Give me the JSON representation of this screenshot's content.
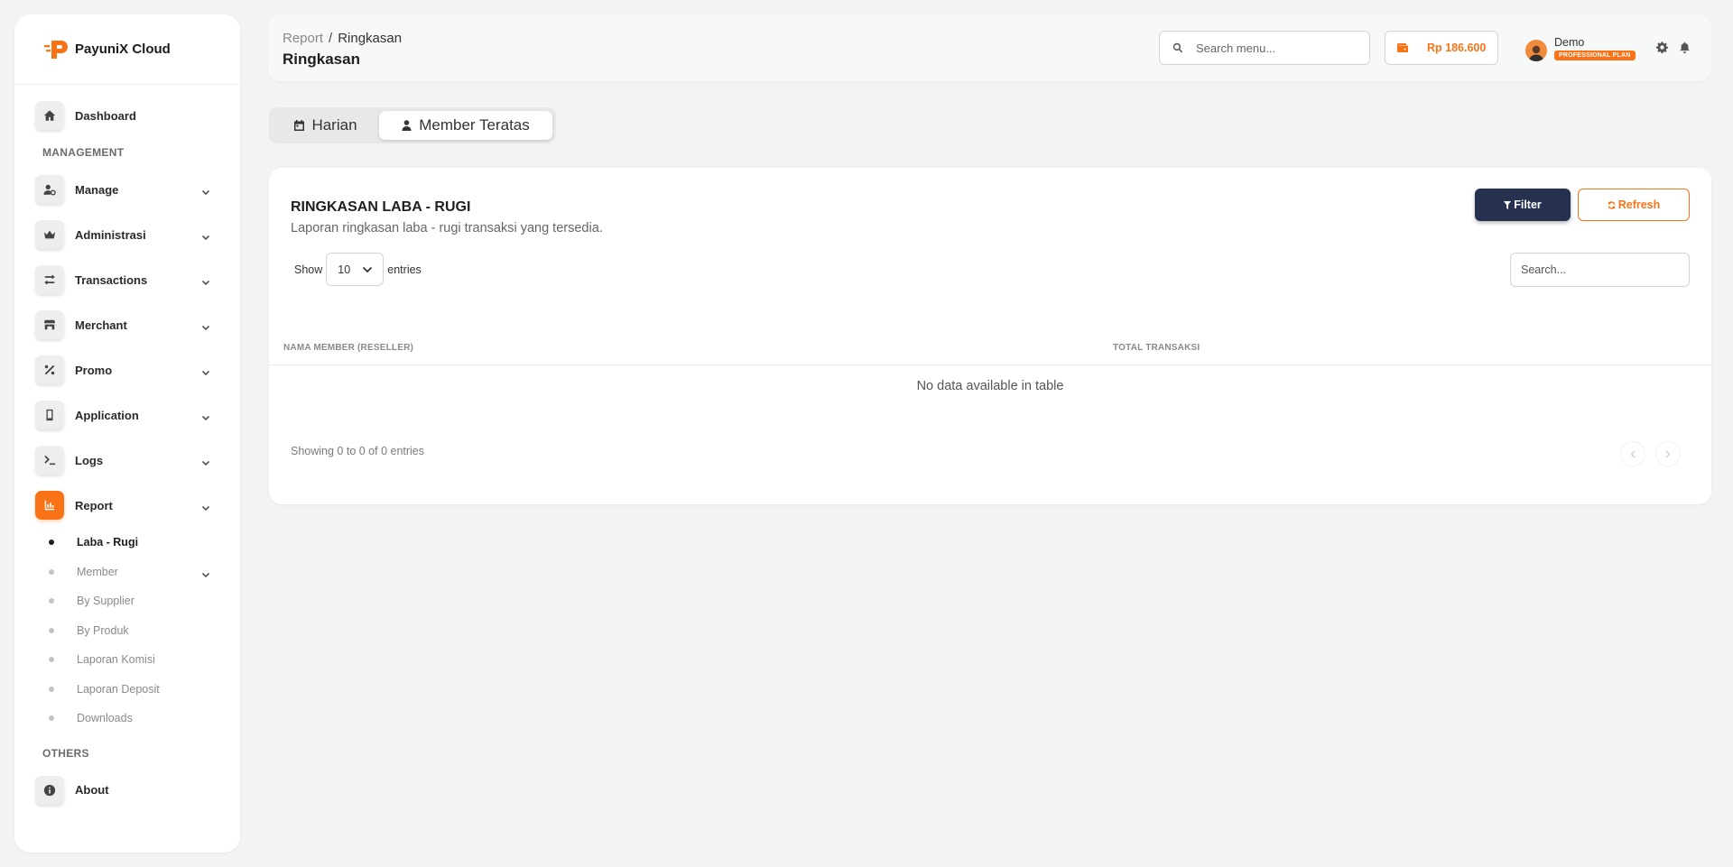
{
  "brand": {
    "name": "PayuniX Cloud"
  },
  "sidebar": {
    "dashboard": "Dashboard",
    "management_title": "MANAGEMENT",
    "menu": [
      {
        "label": "Manage",
        "icon": "user-gear-icon"
      },
      {
        "label": "Administrasi",
        "icon": "crown-icon"
      },
      {
        "label": "Transactions",
        "icon": "arrows-exchange-icon"
      },
      {
        "label": "Merchant",
        "icon": "store-icon"
      },
      {
        "label": "Promo",
        "icon": "percent-icon"
      },
      {
        "label": "Application",
        "icon": "mobile-icon"
      },
      {
        "label": "Logs",
        "icon": "terminal-icon"
      },
      {
        "label": "Report",
        "icon": "chart-icon"
      }
    ],
    "report_sub": [
      "Laba - Rugi",
      "Member",
      "By Supplier",
      "By Produk",
      "Laporan Komisi",
      "Laporan Deposit",
      "Downloads"
    ],
    "others_title": "OTHERS",
    "about": "About"
  },
  "header": {
    "breadcrumb_root": "Report",
    "breadcrumb_sep": "/",
    "breadcrumb_current": "Ringkasan",
    "title": "Ringkasan",
    "search_placeholder": "Search menu...",
    "balance": "Rp 186.600",
    "user_name": "Demo",
    "plan": "PROFESSIONAL PLAN"
  },
  "tabs": {
    "daily": "Harian",
    "top_member": "Member Teratas"
  },
  "card": {
    "title": "RINGKASAN LABA - RUGI",
    "subtitle": "Laporan ringkasan laba - rugi transaksi yang tersedia.",
    "filter_label": "Filter",
    "refresh_label": "Refresh",
    "show_label": "Show",
    "entries_label": "entries",
    "length_value": "10",
    "search_placeholder": "Search...",
    "columns": [
      "NAMA MEMBER (RESELLER)",
      "TOTAL TRANSAKSI"
    ],
    "empty_text": "No data available in table",
    "info": "Showing 0 to 0 of 0 entries"
  },
  "colors": {
    "accent": "#f97316",
    "filter_button": "#263150"
  }
}
